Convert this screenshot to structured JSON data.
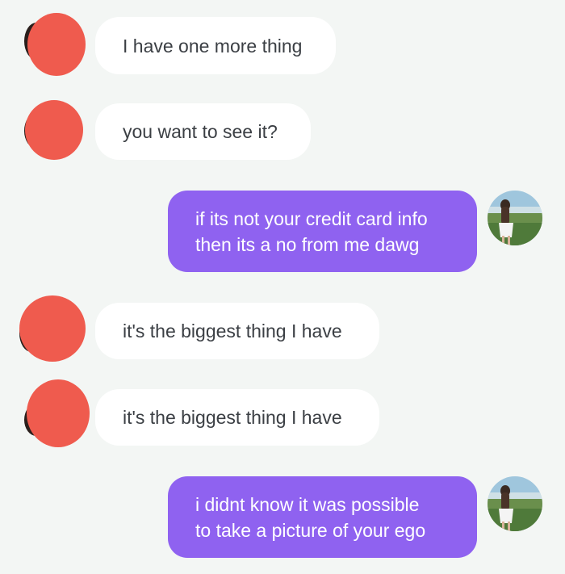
{
  "colors": {
    "background": "#f3f6f4",
    "received_bubble": "#ffffff",
    "received_text": "#3b3f44",
    "sent_bubble": "#8f62f0",
    "sent_text": "#ffffff",
    "redaction": "#ef5b4e"
  },
  "messages": [
    {
      "direction": "received",
      "lines": [
        "I have one more thing"
      ]
    },
    {
      "direction": "received",
      "lines": [
        "you want to see it?"
      ]
    },
    {
      "direction": "sent",
      "lines": [
        "if its not your credit card info",
        "then its a no from me dawg"
      ]
    },
    {
      "direction": "received",
      "lines": [
        "it's the biggest thing I have"
      ]
    },
    {
      "direction": "received",
      "lines": [
        "it's the biggest thing I have"
      ]
    },
    {
      "direction": "sent",
      "lines": [
        "i didnt know it was possible",
        "to take a picture of your ego"
      ]
    }
  ],
  "icons": {
    "sender_avatar": "redacted-avatar-icon",
    "user_avatar": "user-photo-avatar-icon"
  }
}
